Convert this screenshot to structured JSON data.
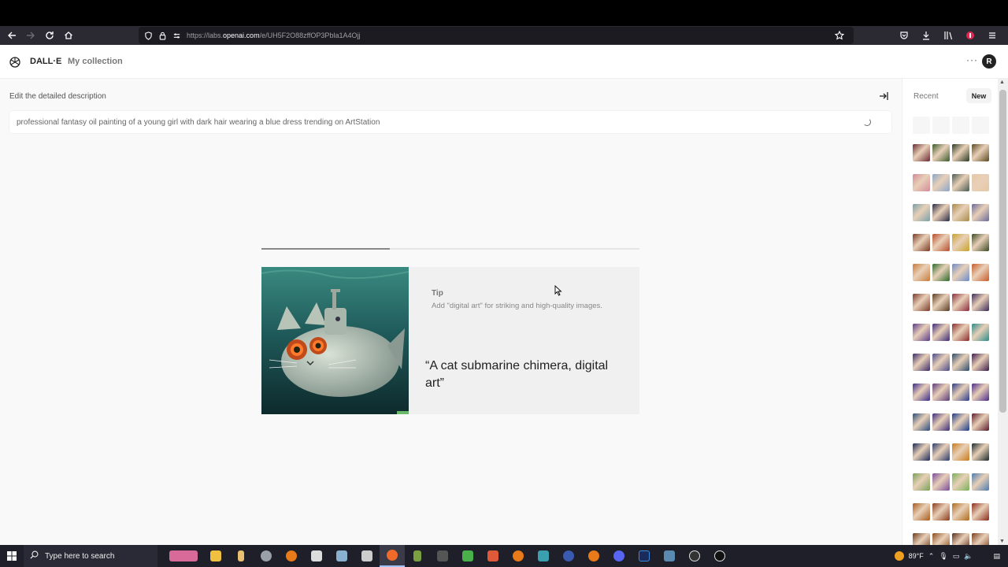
{
  "browser": {
    "url_prefix": "https://labs.",
    "url_domain": "openai.com",
    "url_path": "/e/UH5F2O88zffOP3Pbla1A4Ojj"
  },
  "app": {
    "brand": "DALL·E",
    "collection_link": "My collection",
    "more_menu": "···",
    "avatar_initial": "R"
  },
  "editor": {
    "label": "Edit the detailed description",
    "prompt_value": "professional fantasy oil painting of a young girl with dark hair wearing a blue dress trending on ArtStation",
    "progress": 0.34
  },
  "tip": {
    "title": "Tip",
    "text": "Add \"digital art\" for striking and high-quality images.",
    "quote": "“A cat submarine chimera, digital art”"
  },
  "sidebar": {
    "recent_label": "Recent",
    "new_button": "New",
    "thumb_colors": [
      "#6a2a33",
      "#3a5a2a",
      "#2a3a22",
      "#5a4a22",
      "#d48a9a",
      "#8aa6c8",
      "#4a5a52",
      "#e6c8a6",
      "#7aa0a8",
      "#2a2a44",
      "#a88a4a",
      "#6a6a9a",
      "#7a3a22",
      "#b84a2a",
      "#c8a22a",
      "#3a4a22",
      "#c87a3a",
      "#2a6a2a",
      "#6a8ac8",
      "#c85a2a",
      "#7a3a2a",
      "#5a3a22",
      "#8a2a3a",
      "#3a2a5a",
      "#5a3a8a",
      "#3a2a7a",
      "#8a2a2a",
      "#2a8a8a",
      "#3a2a6a",
      "#4a4a8a",
      "#2a4a6a",
      "#3a1a4a",
      "#3a2a8a",
      "#5a3a7a",
      "#2a3a8a",
      "#4a2a8a",
      "#2a4a7a",
      "#3a2a7a",
      "#1a3a8a",
      "#5a1a2a",
      "#1a2a5a",
      "#2a3a6a",
      "#c87a1a",
      "#1a2a2a",
      "#7aa05a",
      "#7a4a9a",
      "#7ab05a",
      "#4a7ab0",
      "#a85a1a",
      "#8a3a1a",
      "#b06a1a",
      "#8a2a1a",
      "#6a3a1a",
      "#8a4a1a",
      "#5a2a1a",
      "#7a3a1a"
    ]
  },
  "taskbar": {
    "search_placeholder": "Type here to search",
    "weather": "89°F"
  }
}
